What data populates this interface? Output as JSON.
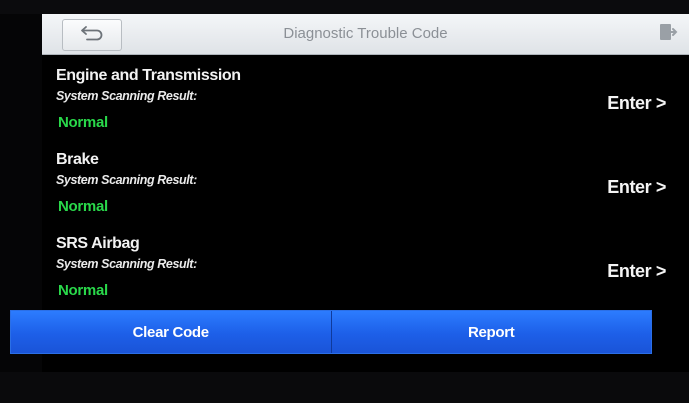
{
  "header": {
    "title": "Diagnostic Trouble Code",
    "back_icon": "back-arrow-icon",
    "exit_icon": "exit-icon"
  },
  "systems": [
    {
      "name": "Engine and Transmission",
      "label": "System Scanning Result:",
      "status": "Normal",
      "enter_label": "Enter >"
    },
    {
      "name": "Brake",
      "label": "System Scanning Result:",
      "status": "Normal",
      "enter_label": "Enter >"
    },
    {
      "name": "SRS Airbag",
      "label": "System Scanning Result:",
      "status": "Normal",
      "enter_label": "Enter >"
    }
  ],
  "footer": {
    "clear_label": "Clear Code",
    "report_label": "Report"
  },
  "colors": {
    "status_normal": "#29d84a",
    "button_blue": "#1d5fe8",
    "header_bg": "#e8ebee"
  }
}
